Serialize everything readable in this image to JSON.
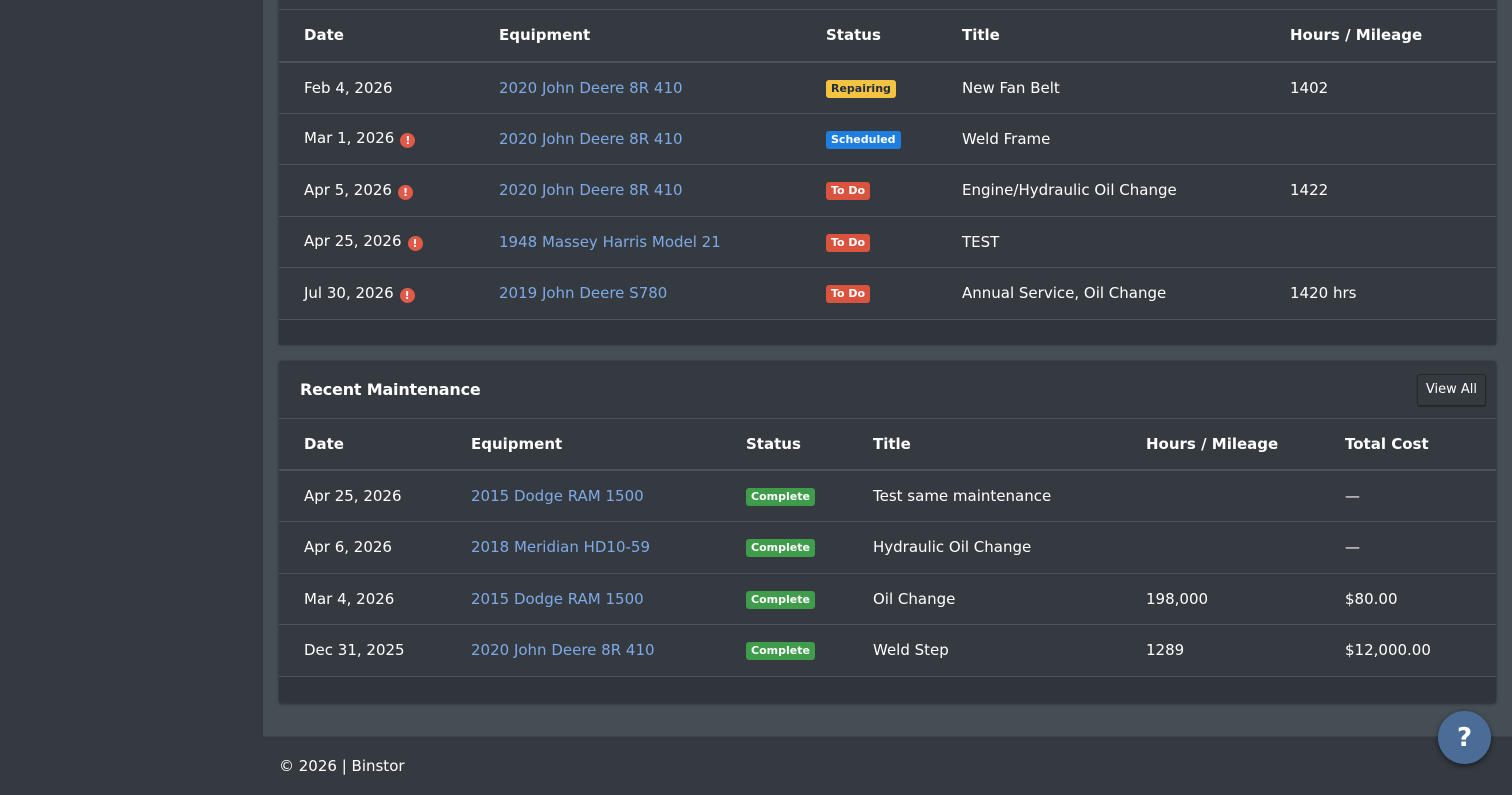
{
  "upcoming": {
    "columns": [
      "Date",
      "Equipment",
      "Status",
      "Title",
      "Hours / Mileage"
    ],
    "rows": [
      {
        "date": "Feb 4, 2026",
        "equipment": "2020 John Deere 8R 410",
        "status": "Repairing",
        "title": "New Fan Belt",
        "hours": "1402",
        "overdue": false
      },
      {
        "date": "Mar 1, 2026",
        "equipment": "2020 John Deere 8R 410",
        "status": "Scheduled",
        "title": "Weld Frame",
        "hours": "",
        "overdue": true
      },
      {
        "date": "Apr 5, 2026",
        "equipment": "2020 John Deere 8R 410",
        "status": "To Do",
        "title": "Engine/Hydraulic Oil Change",
        "hours": "1422",
        "overdue": true
      },
      {
        "date": "Apr 25, 2026",
        "equipment": "1948 Massey Harris Model 21",
        "status": "To Do",
        "title": "TEST",
        "hours": "",
        "overdue": true
      },
      {
        "date": "Jul 30, 2026",
        "equipment": "2019 John Deere S780",
        "status": "To Do",
        "title": "Annual Service, Oil Change",
        "hours": "1420 hrs",
        "overdue": true
      }
    ]
  },
  "recent": {
    "title": "Recent Maintenance",
    "view_all_label": "View All",
    "columns": [
      "Date",
      "Equipment",
      "Status",
      "Title",
      "Hours / Mileage",
      "Total Cost"
    ],
    "rows": [
      {
        "date": "Apr 25, 2026",
        "equipment": "2015 Dodge RAM 1500",
        "status": "Complete",
        "title": "Test same maintenance",
        "hours": "",
        "cost": "—"
      },
      {
        "date": "Apr 6, 2026",
        "equipment": "2018 Meridian HD10-59",
        "status": "Complete",
        "title": "Hydraulic Oil Change",
        "hours": "",
        "cost": "—"
      },
      {
        "date": "Mar 4, 2026",
        "equipment": "2015 Dodge RAM 1500",
        "status": "Complete",
        "title": "Oil Change",
        "hours": "198,000",
        "cost": "$80.00"
      },
      {
        "date": "Dec 31, 2025",
        "equipment": "2020 John Deere 8R 410",
        "status": "Complete",
        "title": "Weld Step",
        "hours": "1289",
        "cost": "$12,000.00"
      }
    ]
  },
  "overdue_icon": "exclamation-circle-icon",
  "overdue_glyph": "!",
  "footer": {
    "text": "© 2026 | Binstor"
  },
  "help": {
    "glyph": "?",
    "icon": "question-icon"
  },
  "colors": {
    "background": "#454d55",
    "card": "#343a40",
    "link": "#7fa9e6",
    "repairing": "#f5c342",
    "scheduled": "#1f7fe0",
    "todo": "#d9533f",
    "complete": "#3f9c4a",
    "help_button": "#4a6c96"
  }
}
